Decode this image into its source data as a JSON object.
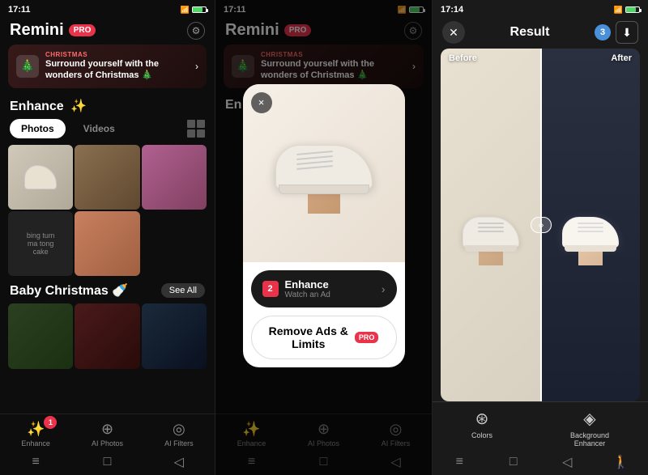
{
  "panel1": {
    "status": {
      "time": "17:11",
      "battery_indicator": "battery"
    },
    "header": {
      "logo": "Remini",
      "pro_label": "PRO"
    },
    "banner": {
      "tag": "CHRISTMAS",
      "title": "Surround yourself with the wonders of Christmas 🎄",
      "icon": "🎄"
    },
    "enhance_section": {
      "title": "Enhance",
      "title_icon": "✨",
      "photos_btn": "Photos",
      "videos_btn": "Videos"
    },
    "baby_section": {
      "title": "Baby Christmas 🍼",
      "see_all": "See All"
    },
    "bottom_nav": [
      {
        "label": "Enhance",
        "icon": "✨",
        "badge": "1"
      },
      {
        "label": "AI Photos",
        "icon": "⊕"
      },
      {
        "label": "AI Filters",
        "icon": "◎"
      }
    ]
  },
  "panel2": {
    "status": {
      "time": "17:11"
    },
    "header": {
      "logo": "Remini",
      "pro_label": "PRO"
    },
    "banner": {
      "tag": "CHRISTMAS",
      "title": "Surround yourself with the wonders of Christmas 🎄"
    },
    "enhance_section": {
      "title": "En"
    },
    "modal": {
      "enhance_btn": {
        "badge": "2",
        "title": "Enhance",
        "subtitle": "Watch an Ad",
        "chevron": "›"
      },
      "remove_btn": {
        "text": "Remove Ads &\nLimits",
        "pro_label": "PRO"
      },
      "close": "×"
    },
    "bottom_nav": [
      {
        "label": "Enhance",
        "icon": "✨"
      },
      {
        "label": "AI Photos",
        "icon": "⊕"
      },
      {
        "label": "AI Filters",
        "icon": "◎"
      }
    ]
  },
  "panel3": {
    "status": {
      "time": "17:14"
    },
    "header": {
      "title": "Result",
      "badge": "3",
      "download_icon": "⬇"
    },
    "before_label": "Before",
    "after_label": "After",
    "bottom_tools": [
      {
        "label": "Colors",
        "icon": "⊛"
      },
      {
        "label": "Background\nEnhancer",
        "icon": "◈"
      }
    ]
  }
}
